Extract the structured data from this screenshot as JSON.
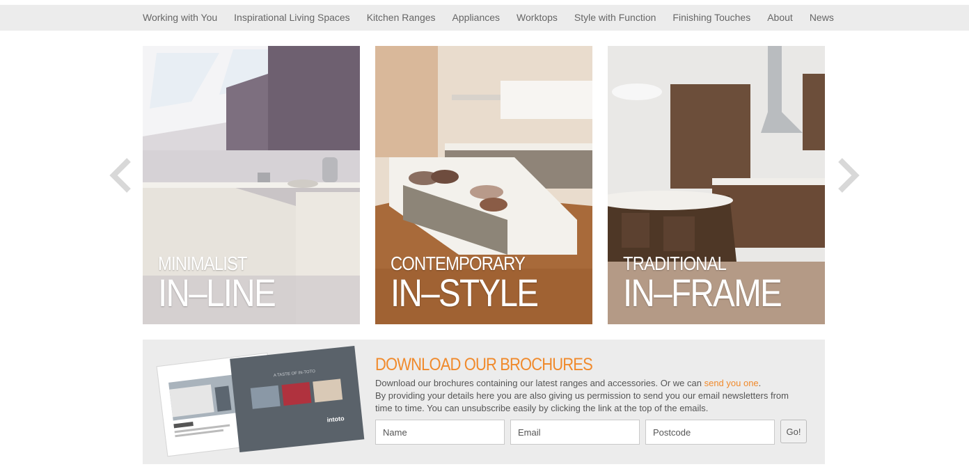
{
  "nav": {
    "items": [
      {
        "label": "Working with You"
      },
      {
        "label": "Inspirational Living Spaces"
      },
      {
        "label": "Kitchen Ranges"
      },
      {
        "label": "Appliances"
      },
      {
        "label": "Worktops"
      },
      {
        "label": "Style with Function"
      },
      {
        "label": "Finishing Touches"
      },
      {
        "label": "About"
      },
      {
        "label": "News"
      }
    ]
  },
  "tiles": [
    {
      "small": "MINIMALIST",
      "big": "IN–LINE"
    },
    {
      "small": "CONTEMPORARY",
      "big": "IN–STYLE"
    },
    {
      "small": "TRADITIONAL",
      "big": "IN–FRAME"
    }
  ],
  "carousel": {
    "prev_icon": "chevron-left-icon",
    "next_icon": "chevron-right-icon"
  },
  "brochure": {
    "title": "DOWNLOAD OUR BROCHURES",
    "line1": "Download our brochures containing our latest ranges and accessories. Or we can ",
    "link": "send you one",
    "line1_end": ".",
    "line2": "By providing your details here you are also giving us permission to send you our email newsletters from time to time. You can unsubscribe easily by clicking the link at the top of the emails.",
    "name_placeholder": "Name",
    "email_placeholder": "Email",
    "postcode_placeholder": "Postcode",
    "go_label": "Go!",
    "cover_tagline": "A TASTE OF IN-TOTO",
    "cover_brand": "intoto"
  },
  "colors": {
    "accent": "#f08a2c",
    "nav_bg": "#ececec",
    "panel_bg": "#ececec"
  }
}
